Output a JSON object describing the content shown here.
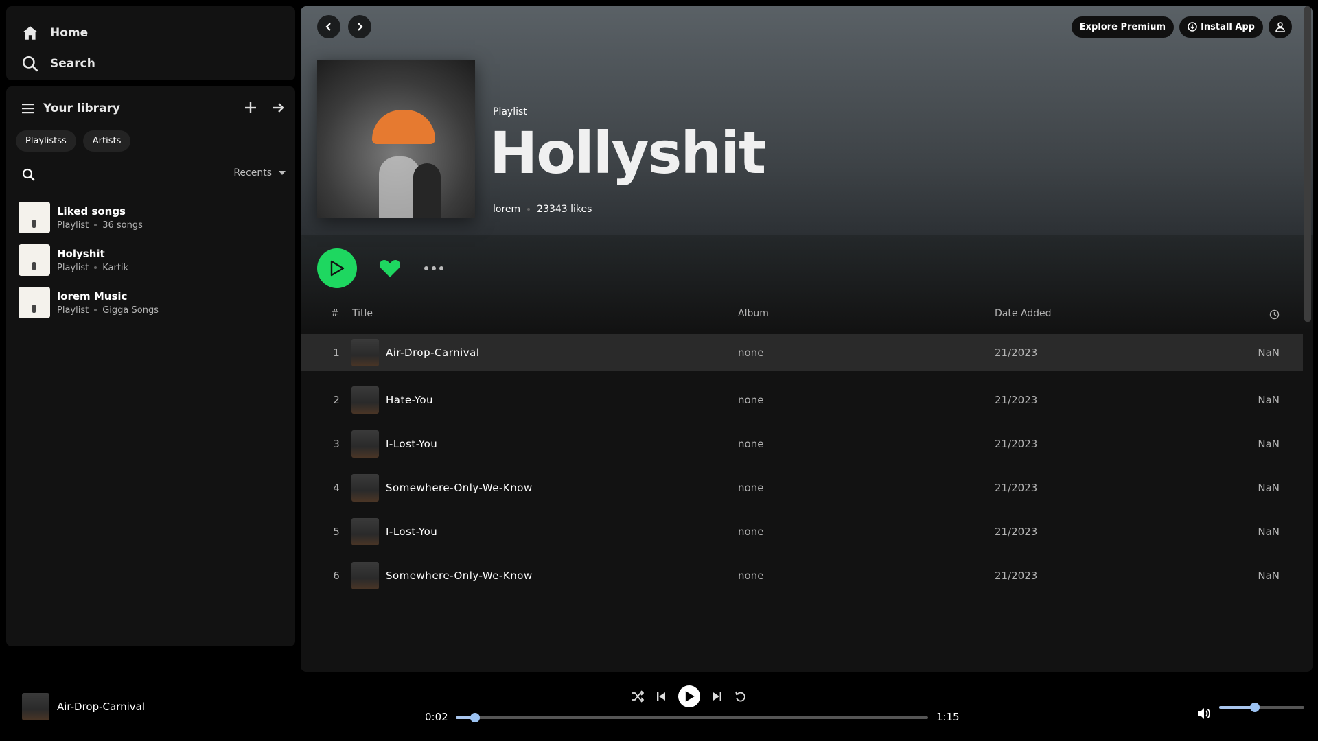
{
  "nav": {
    "home": "Home",
    "search": "Search"
  },
  "library": {
    "title": "Your library",
    "chips": [
      "Playlistss",
      "Artists"
    ],
    "sort_label": "Recents",
    "items": [
      {
        "name": "Liked songs",
        "type": "Playlist",
        "meta": "36 songs"
      },
      {
        "name": "Holyshit",
        "type": "Playlist",
        "meta": "Kartik"
      },
      {
        "name": "lorem Music",
        "type": "Playlist",
        "meta": "Gigga Songs"
      }
    ]
  },
  "header": {
    "explore_premium": "Explore Premium",
    "install_app": "Install App"
  },
  "playlist": {
    "type_label": "Playlist",
    "title": "Hollyshit",
    "owner": "lorem",
    "likes": "23343 likes"
  },
  "table": {
    "headers": {
      "num": "#",
      "title": "Title",
      "album": "Album",
      "date": "Date Added"
    },
    "rows": [
      {
        "num": "1",
        "title": "Air-Drop-Carnival",
        "album": "none",
        "date": "21/2023",
        "duration": "NaN"
      },
      {
        "num": "2",
        "title": "Hate-You",
        "album": "none",
        "date": "21/2023",
        "duration": "NaN"
      },
      {
        "num": "3",
        "title": "I-Lost-You",
        "album": "none",
        "date": "21/2023",
        "duration": "NaN"
      },
      {
        "num": "4",
        "title": "Somewhere-Only-We-Know",
        "album": "none",
        "date": "21/2023",
        "duration": "NaN"
      },
      {
        "num": "5",
        "title": "I-Lost-You",
        "album": "none",
        "date": "21/2023",
        "duration": "NaN"
      },
      {
        "num": "6",
        "title": "Somewhere-Only-We-Know",
        "album": "none",
        "date": "21/2023",
        "duration": "NaN"
      }
    ]
  },
  "player": {
    "now_playing": "Air-Drop-Carnival",
    "current_time": "0:02",
    "total_time": "1:15",
    "progress": 0.04,
    "volume": 0.42
  },
  "colors": {
    "accent": "#1ed760",
    "slider": "#9cc3f3",
    "background": "#121212"
  }
}
